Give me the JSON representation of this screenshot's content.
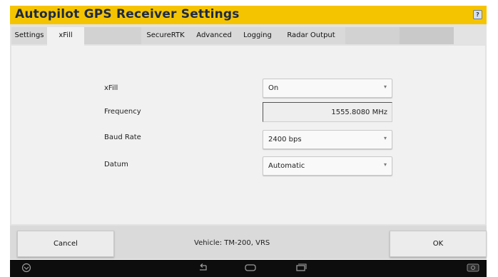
{
  "window": {
    "title": "Autopilot GPS Receiver Settings",
    "help_icon": "?"
  },
  "tabs": [
    {
      "label": "Settings"
    },
    {
      "label": "xFill"
    },
    {
      "label": ""
    },
    {
      "label": "SecureRTK"
    },
    {
      "label": "Advanced"
    },
    {
      "label": "Logging"
    },
    {
      "label": "Radar Output"
    },
    {
      "label": ""
    }
  ],
  "active_tab": "xFill",
  "form": {
    "xfill": {
      "label": "xFill",
      "value": "On"
    },
    "frequency": {
      "label": "Frequency",
      "value": "1555.8080 MHz"
    },
    "baud_rate": {
      "label": "Baud Rate",
      "value": "2400 bps"
    },
    "datum": {
      "label": "Datum",
      "value": "Automatic"
    }
  },
  "footer": {
    "cancel_label": "Cancel",
    "vehicle_text": "Vehicle: TM-200, VRS",
    "ok_label": "OK"
  },
  "navbar": {
    "icons": [
      "shield-icon",
      "back-icon",
      "home-icon",
      "recent-apps-icon",
      "screenshot-icon"
    ]
  },
  "colors": {
    "titlebar": "#f5c400",
    "title_text": "#1d2a44",
    "navbar": "#0d0d0d"
  }
}
